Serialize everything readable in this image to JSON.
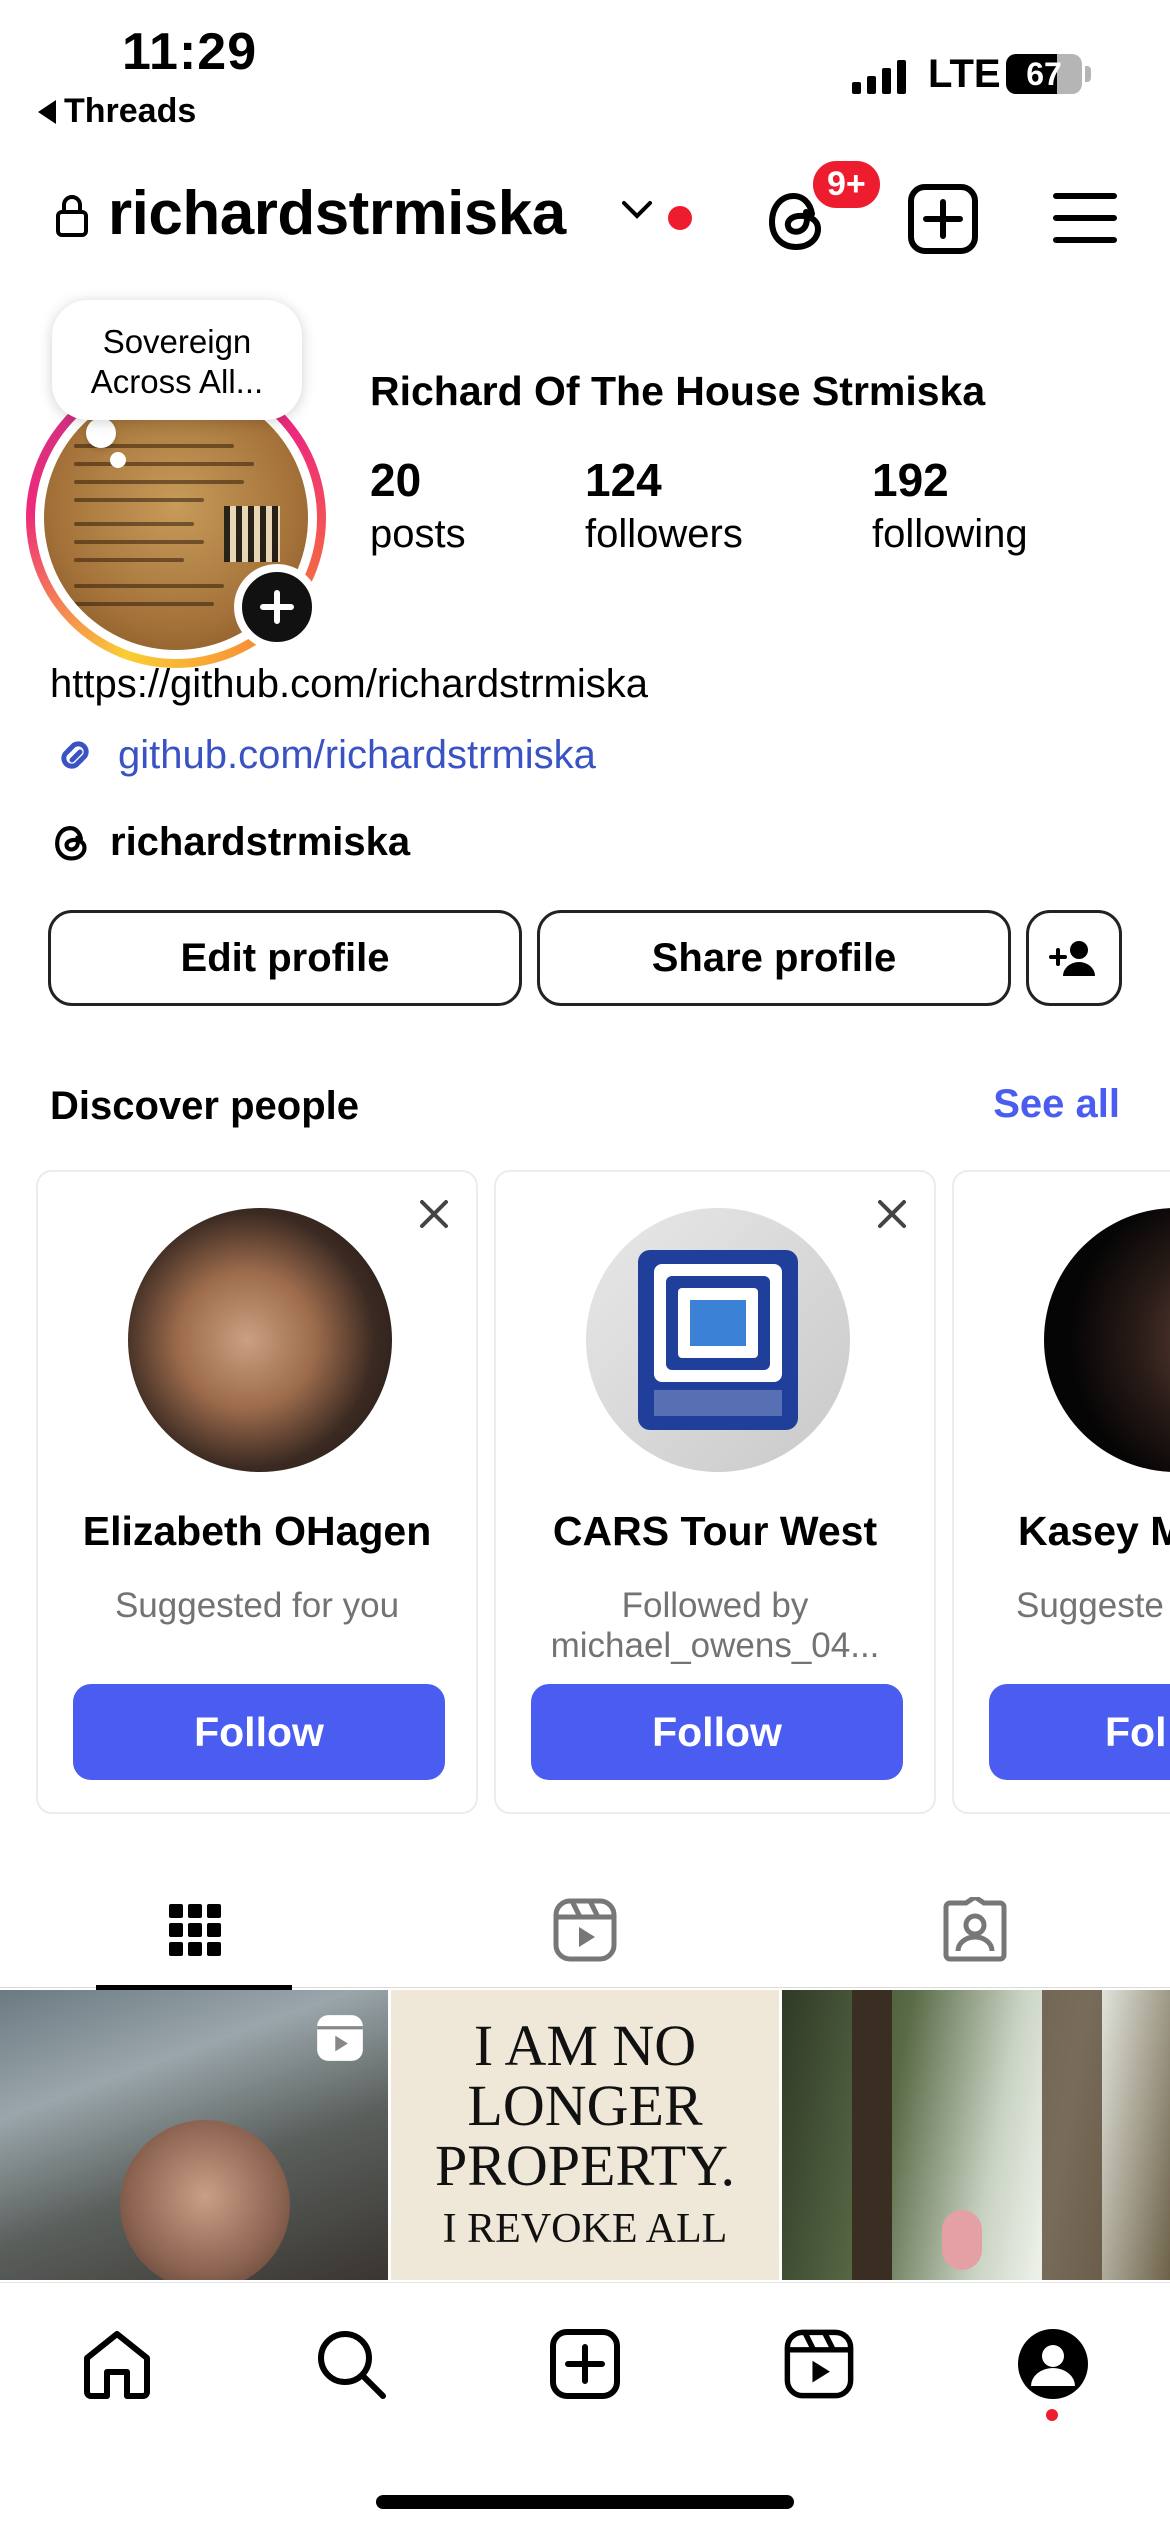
{
  "status_bar": {
    "time": "11:29",
    "back_app": "Threads",
    "network": "LTE",
    "battery": "67",
    "battery_level": 0.67
  },
  "header": {
    "username": "richardstrmiska",
    "threads_badge": "9+"
  },
  "profile": {
    "note": "Sovereign Across All...",
    "full_name": "Richard Of The House Strmiska",
    "stats": [
      {
        "value": "20",
        "label": "posts"
      },
      {
        "value": "124",
        "label": "followers"
      },
      {
        "value": "192",
        "label": "following"
      }
    ],
    "bio": "https://github.com/richardstrmiska",
    "link": "github.com/richardstrmiska",
    "threads_handle": "richardstrmiska"
  },
  "actions": {
    "edit": "Edit profile",
    "share": "Share profile"
  },
  "discover": {
    "title": "Discover people",
    "see_all": "See all",
    "cards": [
      {
        "name": "Elizabeth OHagen",
        "subtitle": "Suggested for you",
        "button": "Follow"
      },
      {
        "name": "CARS Tour West",
        "subtitle": "Followed by michael_owens_04...",
        "button": "Follow"
      },
      {
        "name": "Kasey M",
        "subtitle": "Suggeste",
        "button": "Fol"
      }
    ]
  },
  "posts": {
    "quote_line1": "I AM NO",
    "quote_line2": "LONGER",
    "quote_line3": "PROPERTY.",
    "quote_line4": "I REVOKE ALL"
  },
  "icons": {
    "lock": "lock-icon",
    "chevron": "chevron-down-icon",
    "threads": "threads-icon",
    "add": "add-square-icon",
    "menu": "hamburger-menu-icon",
    "link": "link-icon",
    "add_person": "add-person-icon",
    "close": "close-icon",
    "grid": "grid-icon",
    "reels": "reels-icon",
    "tagged": "tagged-icon",
    "home": "home-icon",
    "search": "search-icon",
    "profile": "profile-icon"
  },
  "colors": {
    "accent": "#4a5df0",
    "link": "#3a53c4",
    "notification": "#ed1c2e"
  }
}
